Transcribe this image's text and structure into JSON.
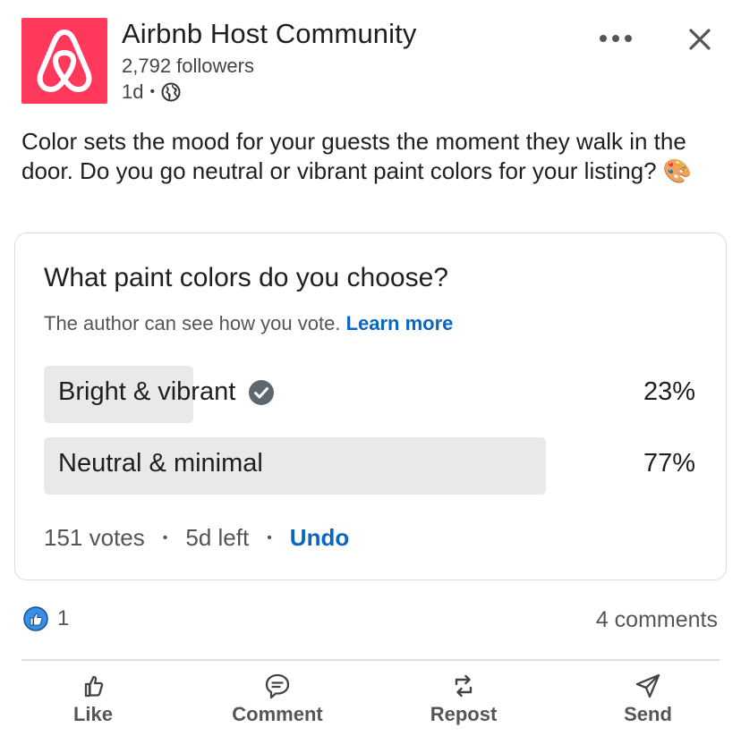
{
  "header": {
    "org_name": "Airbnb Host Community",
    "followers": "2,792 followers",
    "age": "1d",
    "separator": "•",
    "visibility_icon": "globe-icon",
    "brand_color": "#ff385c"
  },
  "post": {
    "text": "Color sets the mood for your guests the moment they walk in the door. Do you go neutral or vibrant paint colors for your listing?",
    "emoji": "🎨"
  },
  "poll": {
    "question": "What paint colors do you choose?",
    "note": "The author can see how you vote.",
    "learn_more": "Learn more",
    "options": [
      {
        "label": "Bright & vibrant",
        "percent": "23%",
        "fraction": 0.23,
        "selected": true
      },
      {
        "label": "Neutral & minimal",
        "percent": "77%",
        "fraction": 0.77,
        "selected": false
      }
    ],
    "votes": "151 votes",
    "time_left": "5d left",
    "undo": "Undo",
    "separator": "•"
  },
  "social": {
    "reaction_count": "1",
    "comments": "4 comments"
  },
  "actions": {
    "like": "Like",
    "comment": "Comment",
    "repost": "Repost",
    "send": "Send"
  },
  "colors": {
    "link": "#0a66c2",
    "poll_fill": "#e9e9e9",
    "like_blue": "#378fe9"
  }
}
